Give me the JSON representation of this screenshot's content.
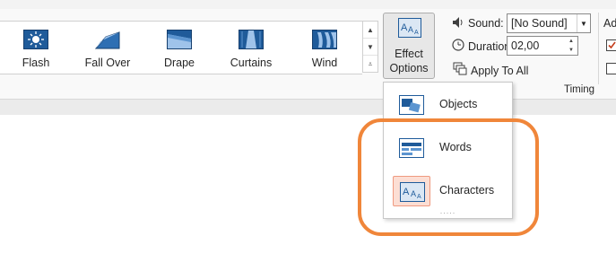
{
  "transitions": [
    {
      "label": "Flash",
      "icon": "flash-transition-icon"
    },
    {
      "label": "Fall Over",
      "icon": "fall-over-transition-icon"
    },
    {
      "label": "Drape",
      "icon": "drape-transition-icon"
    },
    {
      "label": "Curtains",
      "icon": "curtains-transition-icon"
    },
    {
      "label": "Wind",
      "icon": "wind-transition-icon"
    }
  ],
  "effect_options": {
    "line1": "Effect",
    "line2": "Options",
    "caret": "⌄"
  },
  "timing": {
    "sound_label": "Sound:",
    "sound_value": "[No Sound]",
    "duration_label": "Duration:",
    "duration_value": "02,00",
    "apply_all_label": "Apply To All",
    "group_label": "Timing",
    "advance_label_partial": "Ad"
  },
  "dropdown": {
    "items": [
      {
        "label": "Objects",
        "icon": "objects-effect-icon",
        "selected": false
      },
      {
        "label": "Words",
        "icon": "words-effect-icon",
        "selected": false
      },
      {
        "label": "Characters",
        "icon": "characters-effect-icon",
        "selected": true
      }
    ],
    "more_indicator": "....."
  },
  "colors": {
    "accent_blue": "#1f5b9a",
    "highlight_orange": "#f0863a",
    "checkbox_red": "#c43e1c"
  }
}
